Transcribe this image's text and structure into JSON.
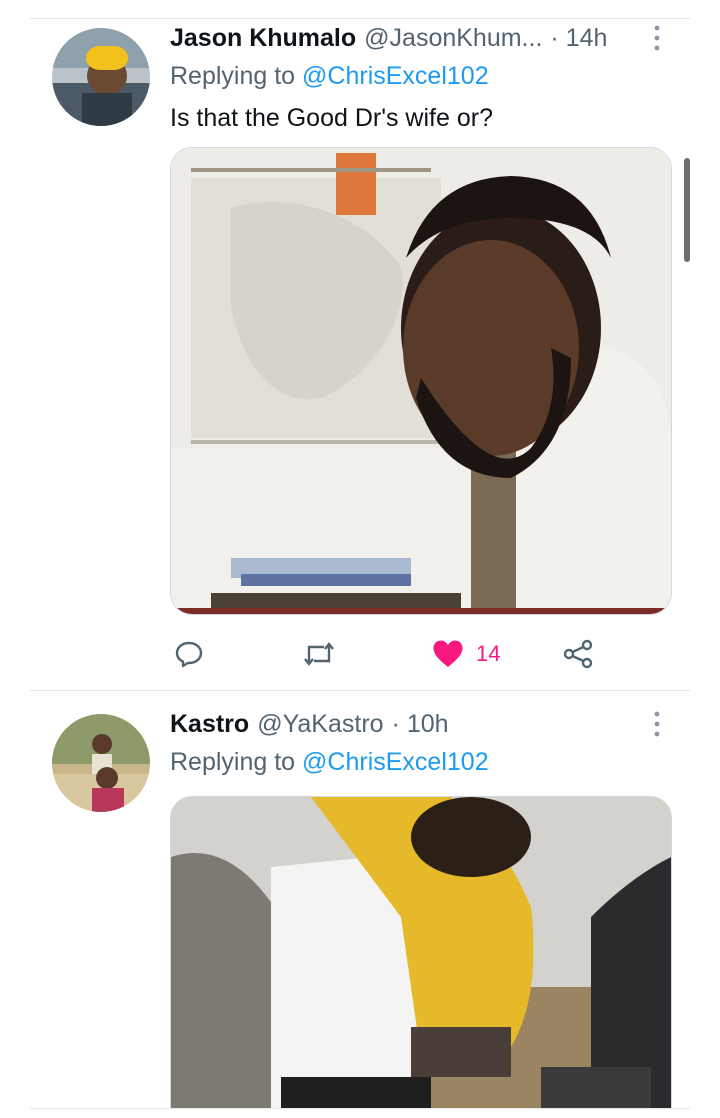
{
  "tweets": [
    {
      "author_name": "Jason Khumalo",
      "handle": "@JasonKhum...",
      "time": "· 14h",
      "replying_prefix": "Replying to ",
      "replying_mention": "@ChrisExcel102",
      "text": "Is that the Good Dr's wife or?",
      "icons": {
        "reply": "reply-icon",
        "retweet": "retweet-icon",
        "like": "heart-filled-icon",
        "share": "share-icon",
        "more": "more-vertical-icon"
      },
      "like_count": "14",
      "liked": true
    },
    {
      "author_name": "Kastro",
      "handle": "@YaKastro",
      "time": "· 10h",
      "replying_prefix": "Replying to ",
      "replying_mention": "@ChrisExcel102",
      "icons": {
        "more": "more-vertical-icon"
      }
    }
  ],
  "colors": {
    "accent": "#1d9bf0",
    "like": "#f91880",
    "secondary_text": "#536471",
    "divider": "#e3e6e8"
  }
}
